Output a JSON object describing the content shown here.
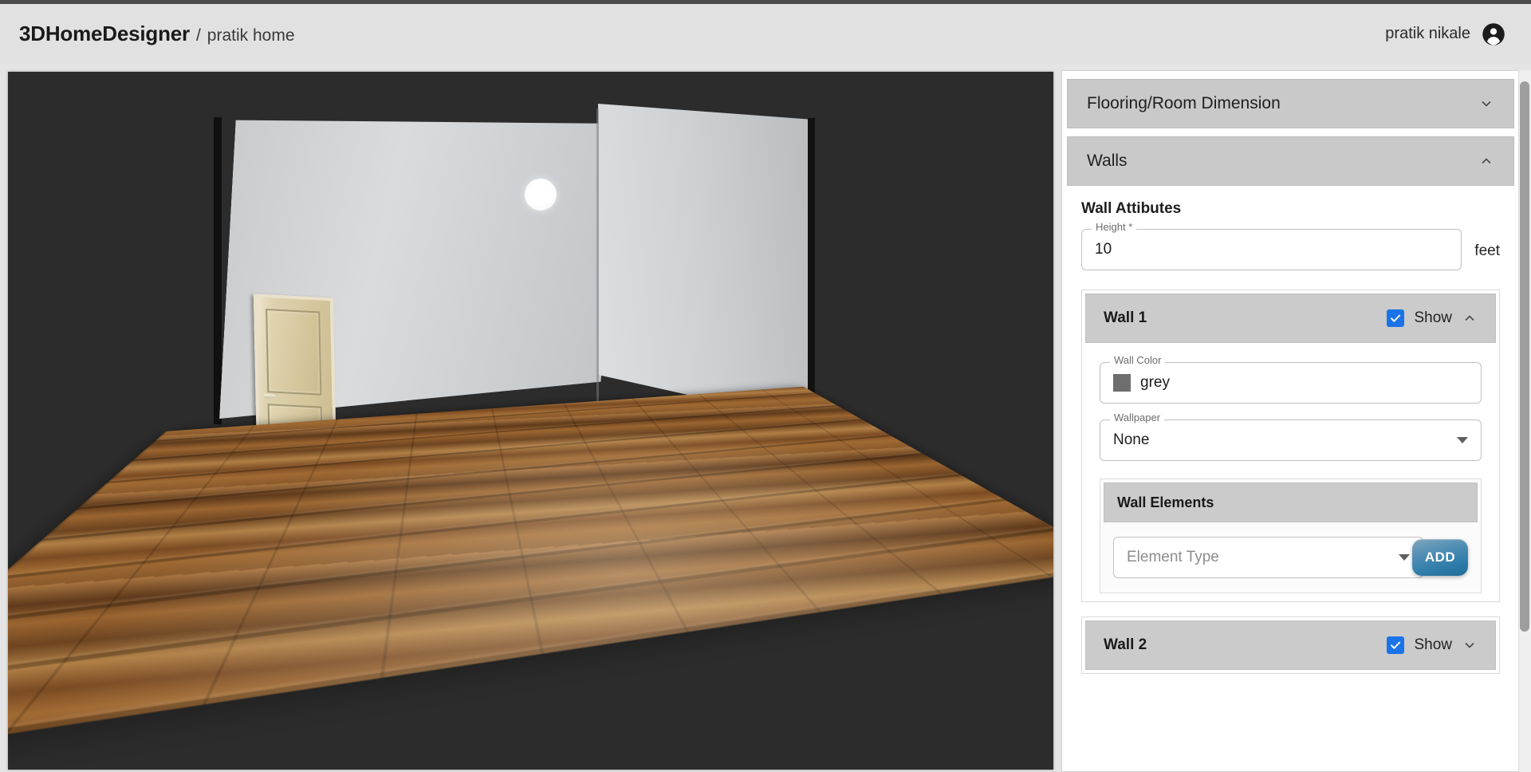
{
  "header": {
    "brand": "3DHomeDesigner",
    "separator": "/",
    "project": "pratik home",
    "user_name": "pratik nikale",
    "account_icon": "account-circle-icon"
  },
  "viewport": {
    "background_color": "#2c2c2c",
    "scene_description": "3D room preview with two grey walls, wooden door and hardwood floor",
    "wall_color": "#cfd2d4",
    "floor_material": "hardwood",
    "light_icon": "ceiling-light-sphere"
  },
  "panel": {
    "sections": [
      {
        "title": "Flooring/Room Dimension",
        "expanded": false,
        "chevron": "chevron-down-icon"
      },
      {
        "title": "Walls",
        "expanded": true,
        "chevron": "chevron-up-icon"
      }
    ],
    "walls": {
      "attributes_title": "Wall Attibutes",
      "height": {
        "label": "Height *",
        "value": "10",
        "unit": "feet"
      },
      "wall_items": [
        {
          "title": "Wall 1",
          "show_label": "Show",
          "show_checked": true,
          "expanded": true,
          "chevron": "chevron-up-icon",
          "wall_color": {
            "label": "Wall Color",
            "value": "grey",
            "swatch_hex": "#6e6e6e"
          },
          "wallpaper": {
            "label": "Wallpaper",
            "value": "None"
          },
          "elements": {
            "title": "Wall Elements",
            "type_placeholder": "Element Type",
            "add_label": "ADD"
          }
        },
        {
          "title": "Wall 2",
          "show_label": "Show",
          "show_checked": true,
          "expanded": false,
          "chevron": "chevron-down-icon"
        }
      ]
    }
  },
  "colors": {
    "accent_blue": "#1a73e8",
    "add_button_blue": "#2b7aa8",
    "header_bg": "#e1e1e1",
    "section_header_bg": "#c9c9c9"
  }
}
